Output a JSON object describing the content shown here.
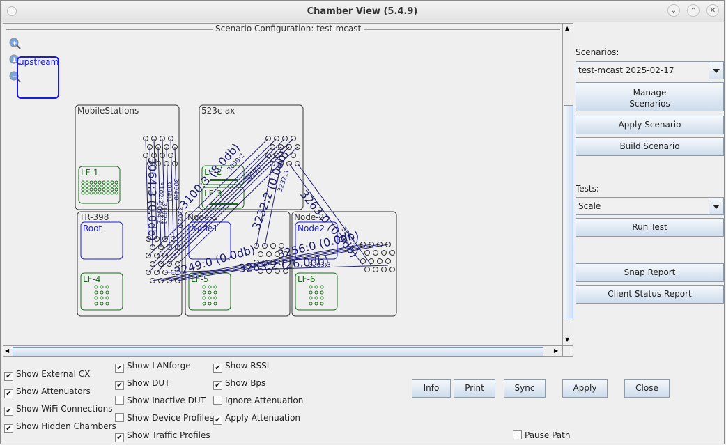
{
  "window": {
    "title": "Chamber View (5.4.9)",
    "controls": [
      "minimize-icon",
      "maximize-icon",
      "close-icon"
    ]
  },
  "canvas": {
    "title": "Scenario Configuration:  test-mcast",
    "zoom_controls": [
      "zoom-in-icon",
      "zoom-reset-icon",
      "zoom-out-icon"
    ],
    "upstream": "upstream",
    "chambers": [
      {
        "name": "MobileStations",
        "devices": [
          {
            "name": "LF-1",
            "type": "lanforge"
          }
        ]
      },
      {
        "name": "523c-ax",
        "devices": [
          {
            "name": "LF-2",
            "type": "lanforge"
          },
          {
            "name": "LF-3",
            "type": "lanforge"
          }
        ]
      },
      {
        "name": "TR-398",
        "devices": [
          {
            "name": "Root",
            "type": "dut"
          },
          {
            "name": "LF-4",
            "type": "lanforge"
          }
        ]
      },
      {
        "name": "Node-1",
        "devices": [
          {
            "name": "Node1",
            "type": "dut"
          },
          {
            "name": "LF-5",
            "type": "lanforge"
          }
        ]
      },
      {
        "name": "Node-2",
        "devices": [
          {
            "name": "Node2",
            "type": "dut"
          },
          {
            "name": "LF-6",
            "type": "lanforge"
          }
        ]
      }
    ],
    "link_labels": [
      "3064:3 (0.0db)",
      "3094:1",
      "3102:2",
      "3102:1",
      "3094:0",
      "3094:2",
      "3102:0",
      "3100:3 (8.0db)",
      "3099:0",
      "3099:2",
      "3232:2 (0.0db)",
      "3232:3",
      "3263:0 (0.0db)",
      "3263:1",
      "3249:0 (0.0db)",
      "3256:0 (0.0db)",
      "3263:2 (26.0db)",
      "3263:3"
    ]
  },
  "right_panel": {
    "scenarios_label": "Scenarios:",
    "scenario_selected": "test-mcast 2025-02-17",
    "manage_line1": "Manage",
    "manage_line2": "Scenarios",
    "apply_scenario": "Apply Scenario",
    "build_scenario": "Build Scenario",
    "tests_label": "Tests:",
    "test_selected": "Scale",
    "run_test": "Run Test",
    "snap_report": "Snap Report",
    "client_status_report": "Client Status Report"
  },
  "options": {
    "col1": [
      {
        "label": "Show External CX",
        "checked": true
      },
      {
        "label": "Show Attenuators",
        "checked": true
      },
      {
        "label": "Show WiFi Connections",
        "checked": true
      },
      {
        "label": "Show Hidden Chambers",
        "checked": true
      }
    ],
    "col2": [
      {
        "label": "Show LANforge",
        "checked": true
      },
      {
        "label": "Show DUT",
        "checked": true
      },
      {
        "label": "Show Inactive DUT",
        "checked": false
      },
      {
        "label": "Show Device Profiles",
        "checked": false
      },
      {
        "label": "Show Traffic Profiles",
        "checked": true
      }
    ],
    "col3": [
      {
        "label": "Show RSSI",
        "checked": true
      },
      {
        "label": "Show Bps",
        "checked": true
      },
      {
        "label": "Ignore Attenuation",
        "checked": false
      },
      {
        "label": "Apply Attenuation",
        "checked": true
      }
    ],
    "pause_path": {
      "label": "Pause Path",
      "checked": false
    }
  },
  "buttons": {
    "info": "Info",
    "print": "Print",
    "sync": "Sync",
    "apply": "Apply",
    "close": "Close"
  },
  "colors": {
    "lanforge": "#1a6e1a",
    "dut": "#1a1ae6",
    "link": "#1c1c6e"
  }
}
